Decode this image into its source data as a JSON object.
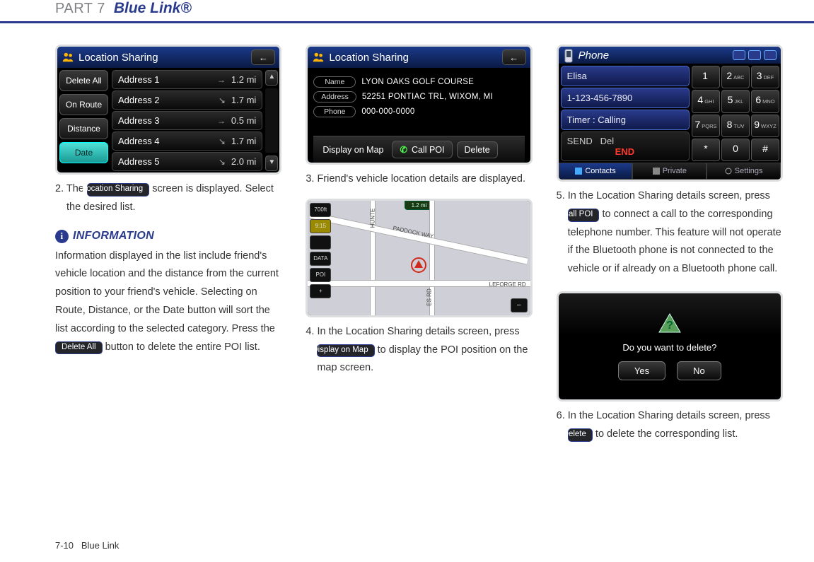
{
  "header": {
    "part": "PART 7",
    "title": "Blue Link®"
  },
  "footer": {
    "page": "7-10",
    "section": "Blue Link"
  },
  "col1": {
    "device": {
      "title": "Location Sharing",
      "leftButtons": [
        "Delete All",
        "On Route",
        "Distance",
        "Date"
      ],
      "rows": [
        {
          "label": "Address 1",
          "arrow": "→",
          "dist": "1.2 mi"
        },
        {
          "label": "Address 2",
          "arrow": "↘",
          "dist": "1.7 mi"
        },
        {
          "label": "Address 3",
          "arrow": "→",
          "dist": "0.5 mi"
        },
        {
          "label": "Address 4",
          "arrow": "↘",
          "dist": "1.7 mi"
        },
        {
          "label": "Address 5",
          "arrow": "↘",
          "dist": "2.0 mi"
        }
      ]
    },
    "step2_a": "2. The ",
    "step2_pill": "Location Sharing",
    "step2_b": " screen is displayed. Select the desired list.",
    "info_title": "INFORMATION",
    "info_body_a": "Information displayed in the list include friend's vehicle location and the distance from the current position to your friend's vehicle. Selecting on Route, Distance, or the Date button will sort the list according to the selected category. Press the ",
    "info_pill": "Delete All",
    "info_body_b": " button to delete the entire POI list."
  },
  "col2": {
    "device": {
      "title": "Location Sharing",
      "name_label": "Name",
      "name_val": "LYON OAKS GOLF COURSE",
      "addr_label": "Address",
      "addr_val": "52251 PONTIAC TRL, WIXOM, MI",
      "phone_label": "Phone",
      "phone_val": "000-000-0000",
      "bottom_display": "Display on Map",
      "bottom_call": "Call POI",
      "bottom_delete": "Delete"
    },
    "step3": "3. Friend's vehicle location details are displayed.",
    "map": {
      "distbox": "1.2 mi",
      "road1": "PADDOCK WAY",
      "road2": "LEFORGE RD",
      "road3": "HUNTE",
      "road4": "ES RD",
      "tools": [
        "700ft",
        "9:15",
        "",
        "DATA",
        "POI"
      ],
      "poiplus": "+",
      "zoom": "−"
    },
    "step4_a": "4. In the Location Sharing details screen, press ",
    "step4_pill": "Display on Map",
    "step4_b": " to display the POI position on the map screen."
  },
  "col3": {
    "phone": {
      "title": "Phone",
      "lines": {
        "name": "Elisa",
        "number": "1-123-456-7890",
        "timer": "Timer : Calling"
      },
      "darkline": {
        "send": "SEND",
        "del": "Del",
        "end": "END"
      },
      "keypad": [
        [
          "1",
          ""
        ],
        [
          "2",
          "ABC"
        ],
        [
          "3",
          "DEF"
        ],
        [
          "4",
          "GHI"
        ],
        [
          "5",
          "JKL"
        ],
        [
          "6",
          "MNO"
        ],
        [
          "7",
          "PQRS"
        ],
        [
          "8",
          "TUV"
        ],
        [
          "9",
          "WXYZ"
        ],
        [
          "*",
          ""
        ],
        [
          "0",
          ""
        ],
        [
          "#",
          ""
        ]
      ],
      "tabs": [
        {
          "label": "Contacts",
          "active": true
        },
        {
          "label": "Private",
          "active": false
        },
        {
          "label": "Settings",
          "active": false
        }
      ]
    },
    "step5_a": "5. In the Location Sharing details screen, press ",
    "step5_pill": "Call POI",
    "step5_b": " to connect a call to the corresponding telephone number. This feature will not operate if the Bluetooth phone is not connected to the vehicle or if already on a Bluetooth phone call.",
    "del_device": {
      "msg": "Do you want to delete?",
      "yes": "Yes",
      "no": "No"
    },
    "step6_a": "6. In the Location Sharing details screen, press ",
    "step6_pill": "Delete",
    "step6_b": " to delete the corresponding list."
  }
}
